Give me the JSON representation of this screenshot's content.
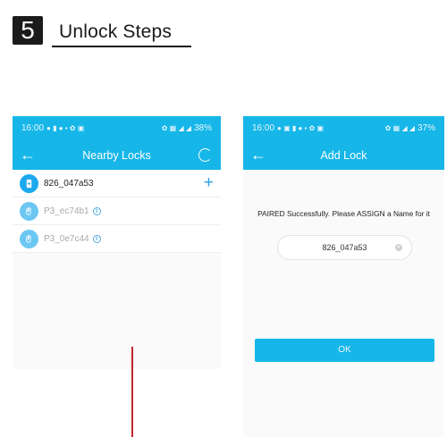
{
  "step": {
    "number": "5",
    "title": "Unlock Steps"
  },
  "left_phone": {
    "status": {
      "time": "16:00",
      "battery": "38%"
    },
    "title": "Nearby Locks",
    "locks": [
      {
        "name": "826_047a53",
        "available": true
      },
      {
        "name": "P3_ec74b1",
        "available": false
      },
      {
        "name": "P3_0e7c44",
        "available": false
      }
    ]
  },
  "right_phone": {
    "status": {
      "time": "16:00",
      "battery": "37%"
    },
    "title": "Add Lock",
    "message": "PAIRED Successfully. Please ASSIGN a Name for it",
    "name_field": {
      "value": "826_047a53"
    },
    "ok_label": "OK"
  },
  "colors": {
    "accent": "#16b6e8",
    "lock_icon": "#1ba9ee",
    "annotation": "#c0262d"
  }
}
